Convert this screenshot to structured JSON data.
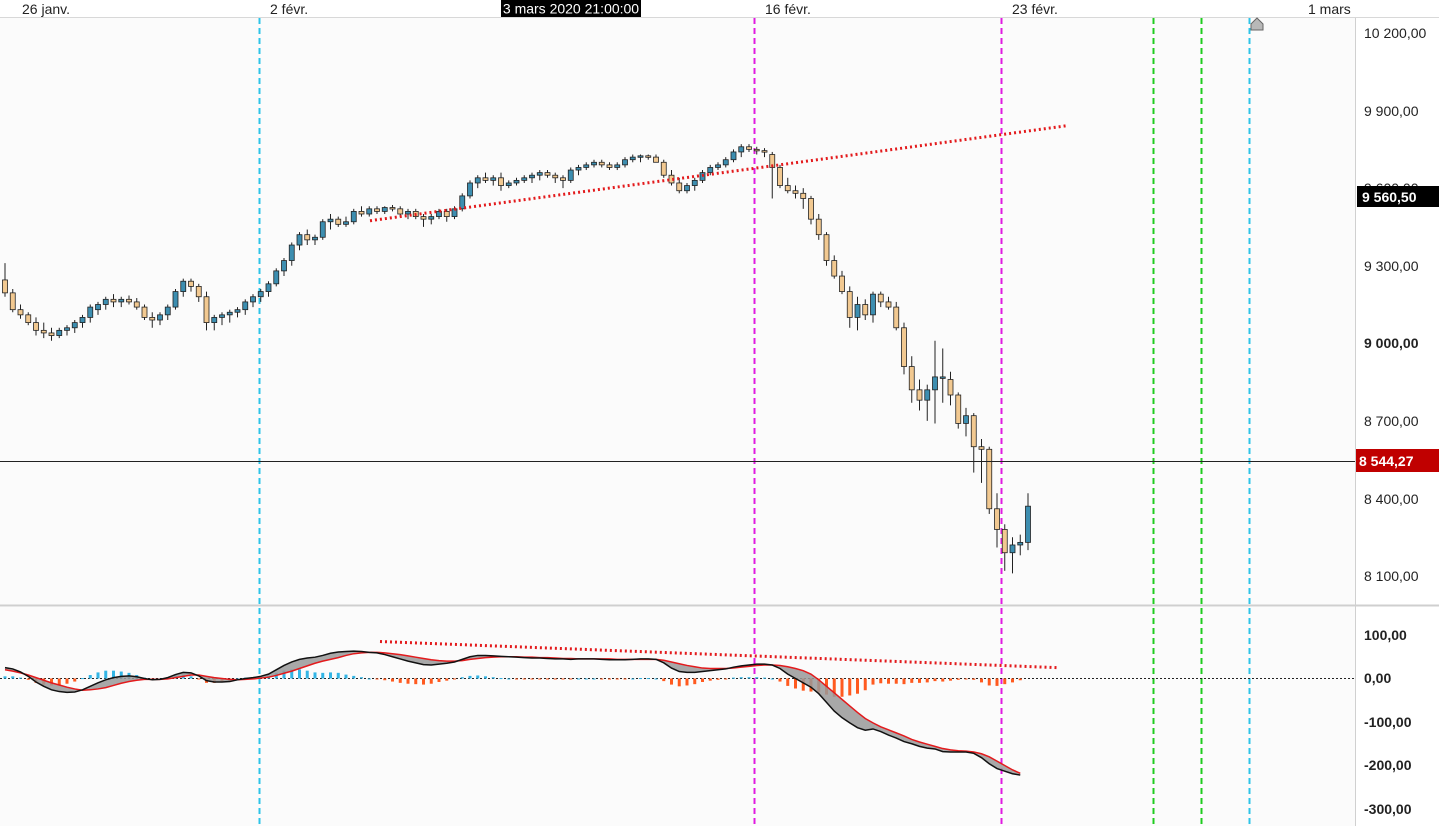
{
  "header": {
    "cursor_time": "3 mars 2020 21:00:00"
  },
  "chart_data": [
    {
      "type": "candlestick",
      "instrument_panel": "price",
      "x_labels": [
        "26 janv.",
        "2 févr.",
        "16 févr.",
        "23 févr.",
        "1 mars"
      ],
      "y_ticks": [
        "10 200,00",
        "9 900,00",
        "9 600,00",
        "9 300,00",
        "9 000,00",
        "8 700,00",
        "8 400,00",
        "8 100,00"
      ],
      "ylim": [
        8050,
        10260
      ],
      "last_price": "9 560,50",
      "crosshair_price": "8 544,27",
      "candles": [
        [
          9245,
          9310,
          9180,
          9195
        ],
        [
          9195,
          9210,
          9120,
          9130
        ],
        [
          9130,
          9150,
          9095,
          9110
        ],
        [
          9110,
          9120,
          9070,
          9080
        ],
        [
          9080,
          9100,
          9030,
          9050
        ],
        [
          9050,
          9080,
          9020,
          9040
        ],
        [
          9040,
          9060,
          9010,
          9030
        ],
        [
          9030,
          9060,
          9020,
          9050
        ],
        [
          9050,
          9070,
          9030,
          9060
        ],
        [
          9060,
          9090,
          9040,
          9080
        ],
        [
          9080,
          9110,
          9060,
          9100
        ],
        [
          9100,
          9150,
          9080,
          9140
        ],
        [
          9130,
          9160,
          9110,
          9150
        ],
        [
          9150,
          9180,
          9130,
          9170
        ],
        [
          9170,
          9190,
          9140,
          9160
        ],
        [
          9160,
          9180,
          9140,
          9170
        ],
        [
          9170,
          9185,
          9150,
          9160
        ],
        [
          9160,
          9175,
          9130,
          9140
        ],
        [
          9140,
          9150,
          9090,
          9100
        ],
        [
          9100,
          9120,
          9060,
          9090
        ],
        [
          9090,
          9120,
          9070,
          9110
        ],
        [
          9110,
          9150,
          9090,
          9140
        ],
        [
          9140,
          9210,
          9130,
          9200
        ],
        [
          9200,
          9250,
          9180,
          9240
        ],
        [
          9240,
          9250,
          9200,
          9220
        ],
        [
          9220,
          9230,
          9160,
          9180
        ],
        [
          9180,
          9200,
          9050,
          9080
        ],
        [
          9080,
          9110,
          9050,
          9100
        ],
        [
          9100,
          9120,
          9070,
          9110
        ],
        [
          9110,
          9130,
          9080,
          9120
        ],
        [
          9120,
          9140,
          9100,
          9130
        ],
        [
          9130,
          9170,
          9110,
          9160
        ],
        [
          9160,
          9190,
          9140,
          9180
        ],
        [
          9180,
          9210,
          9160,
          9200
        ],
        [
          9200,
          9240,
          9180,
          9230
        ],
        [
          9230,
          9290,
          9220,
          9280
        ],
        [
          9280,
          9330,
          9260,
          9320
        ],
        [
          9320,
          9390,
          9300,
          9380
        ],
        [
          9380,
          9430,
          9360,
          9420
        ],
        [
          9420,
          9440,
          9380,
          9400
        ],
        [
          9400,
          9420,
          9380,
          9410
        ],
        [
          9410,
          9480,
          9400,
          9470
        ],
        [
          9470,
          9500,
          9440,
          9480
        ],
        [
          9480,
          9490,
          9450,
          9460
        ],
        [
          9460,
          9490,
          9450,
          9470
        ],
        [
          9470,
          9520,
          9460,
          9510
        ],
        [
          9510,
          9530,
          9490,
          9500
        ],
        [
          9500,
          9530,
          9490,
          9520
        ],
        [
          9520,
          9530,
          9500,
          9510
        ],
        [
          9510,
          9530,
          9500,
          9525
        ],
        [
          9525,
          9535,
          9510,
          9520
        ],
        [
          9520,
          9530,
          9490,
          9500
        ],
        [
          9500,
          9520,
          9480,
          9510
        ],
        [
          9510,
          9520,
          9480,
          9490
        ],
        [
          9490,
          9500,
          9450,
          9480
        ],
        [
          9480,
          9500,
          9460,
          9490
        ],
        [
          9490,
          9520,
          9480,
          9510
        ],
        [
          9510,
          9520,
          9470,
          9490
        ],
        [
          9490,
          9530,
          9480,
          9520
        ],
        [
          9520,
          9580,
          9510,
          9570
        ],
        [
          9570,
          9630,
          9560,
          9620
        ],
        [
          9620,
          9650,
          9600,
          9640
        ],
        [
          9640,
          9660,
          9620,
          9630
        ],
        [
          9630,
          9650,
          9610,
          9640
        ],
        [
          9640,
          9660,
          9590,
          9610
        ],
        [
          9610,
          9630,
          9600,
          9620
        ],
        [
          9620,
          9640,
          9610,
          9630
        ],
        [
          9630,
          9650,
          9620,
          9640
        ],
        [
          9640,
          9660,
          9620,
          9650
        ],
        [
          9650,
          9670,
          9630,
          9660
        ],
        [
          9660,
          9670,
          9640,
          9650
        ],
        [
          9650,
          9660,
          9620,
          9640
        ],
        [
          9640,
          9650,
          9600,
          9630
        ],
        [
          9630,
          9680,
          9620,
          9670
        ],
        [
          9670,
          9690,
          9650,
          9680
        ],
        [
          9680,
          9700,
          9670,
          9690
        ],
        [
          9690,
          9710,
          9680,
          9700
        ],
        [
          9700,
          9710,
          9680,
          9690
        ],
        [
          9690,
          9700,
          9670,
          9680
        ],
        [
          9680,
          9700,
          9670,
          9690
        ],
        [
          9690,
          9720,
          9680,
          9710
        ],
        [
          9710,
          9730,
          9700,
          9720
        ],
        [
          9720,
          9730,
          9700,
          9725
        ],
        [
          9725,
          9730,
          9710,
          9720
        ],
        [
          9720,
          9730,
          9700,
          9700
        ],
        [
          9700,
          9710,
          9640,
          9650
        ],
        [
          9650,
          9670,
          9610,
          9620
        ],
        [
          9620,
          9640,
          9580,
          9590
        ],
        [
          9590,
          9620,
          9580,
          9610
        ],
        [
          9610,
          9640,
          9590,
          9630
        ],
        [
          9630,
          9670,
          9620,
          9660
        ],
        [
          9660,
          9690,
          9650,
          9680
        ],
        [
          9680,
          9700,
          9670,
          9690
        ],
        [
          9690,
          9720,
          9680,
          9710
        ],
        [
          9710,
          9750,
          9700,
          9740
        ],
        [
          9740,
          9770,
          9720,
          9760
        ],
        [
          9760,
          9770,
          9740,
          9750
        ],
        [
          9750,
          9760,
          9730,
          9745
        ],
        [
          9745,
          9755,
          9720,
          9740
        ],
        [
          9730,
          9740,
          9560,
          9680
        ],
        [
          9680,
          9690,
          9600,
          9610
        ],
        [
          9610,
          9640,
          9580,
          9590
        ],
        [
          9590,
          9610,
          9560,
          9580
        ],
        [
          9580,
          9600,
          9520,
          9560
        ],
        [
          9560,
          9570,
          9460,
          9480
        ],
        [
          9480,
          9500,
          9400,
          9420
        ],
        [
          9420,
          9430,
          9300,
          9320
        ],
        [
          9320,
          9340,
          9250,
          9260
        ],
        [
          9260,
          9280,
          9190,
          9200
        ],
        [
          9200,
          9220,
          9060,
          9100
        ],
        [
          9100,
          9180,
          9050,
          9150
        ],
        [
          9150,
          9170,
          9090,
          9110
        ],
        [
          9110,
          9200,
          9080,
          9190
        ],
        [
          9190,
          9200,
          9140,
          9160
        ],
        [
          9160,
          9180,
          9130,
          9140
        ],
        [
          9140,
          9160,
          9050,
          9060
        ],
        [
          9060,
          9080,
          8880,
          8910
        ],
        [
          8910,
          8950,
          8770,
          8820
        ],
        [
          8820,
          8860,
          8740,
          8780
        ],
        [
          8780,
          8840,
          8700,
          8820
        ],
        [
          8820,
          9010,
          8690,
          8870
        ],
        [
          8870,
          8980,
          8770,
          8870
        ],
        [
          8860,
          8890,
          8760,
          8800
        ],
        [
          8800,
          8810,
          8670,
          8690
        ],
        [
          8690,
          8750,
          8640,
          8720
        ],
        [
          8720,
          8730,
          8500,
          8600
        ],
        [
          8600,
          8630,
          8460,
          8590
        ],
        [
          8590,
          8600,
          8340,
          8360
        ],
        [
          8360,
          8420,
          8210,
          8280
        ],
        [
          8280,
          8300,
          8120,
          8190
        ],
        [
          8190,
          8250,
          8110,
          8220
        ],
        [
          8220,
          8260,
          8180,
          8230
        ],
        [
          8230,
          8420,
          8200,
          8370
        ]
      ],
      "trendline": {
        "style": "dotted",
        "color": "#e31a1c",
        "from": [
          9474,
          1
        ],
        "to": [
          9841,
          0
        ]
      },
      "price_line": 8544.27,
      "cursor_marker": "home-marker-icon"
    },
    {
      "type": "line+histogram",
      "instrument_panel": "macd",
      "y_ticks": [
        "100,00",
        "0,00",
        "-100,00",
        "-200,00",
        "-300,00"
      ],
      "ylim": [
        -310,
        120
      ],
      "macd": [
        25,
        22,
        15,
        5,
        -8,
        -18,
        -26,
        -30,
        -32,
        -31,
        -26,
        -18,
        -10,
        -3,
        2,
        5,
        6,
        4,
        0,
        -3,
        -2,
        2,
        9,
        14,
        13,
        6,
        -5,
        -8,
        -8,
        -7,
        -3,
        0,
        2,
        5,
        10,
        20,
        30,
        38,
        44,
        47,
        49,
        53,
        58,
        61,
        62,
        63,
        62,
        60,
        59,
        55,
        50,
        45,
        40,
        36,
        32,
        31,
        33,
        35,
        38,
        44,
        50,
        53,
        53,
        52,
        51,
        50,
        49,
        48,
        47,
        47,
        46,
        45,
        45,
        44,
        45,
        45,
        45,
        44,
        43,
        43,
        43,
        44,
        45,
        45,
        44,
        36,
        24,
        16,
        14,
        14,
        16,
        18,
        20,
        22,
        26,
        29,
        31,
        33,
        33,
        31,
        23,
        10,
        0,
        -10,
        -20,
        -35,
        -55,
        -75,
        -90,
        -102,
        -113,
        -119,
        -116,
        -122,
        -130,
        -137,
        -145,
        -150,
        -156,
        -160,
        -162,
        -168,
        -169,
        -169,
        -169,
        -172,
        -182,
        -196,
        -207,
        -213,
        -219,
        -222
      ],
      "signal": [
        20,
        17,
        13,
        8,
        2,
        -4,
        -10,
        -15,
        -20,
        -24,
        -27,
        -26,
        -24,
        -21,
        -16,
        -11,
        -7,
        -4,
        -2,
        -2,
        -2,
        -1,
        2,
        5,
        8,
        8,
        5,
        2,
        0,
        -2,
        -3,
        -2,
        -1,
        1,
        3,
        7,
        12,
        17,
        23,
        29,
        35,
        40,
        44,
        48,
        53,
        57,
        59,
        60,
        60,
        59,
        57,
        55,
        52,
        49,
        46,
        43,
        41,
        40,
        40,
        41,
        44,
        46,
        48,
        49,
        50,
        50,
        50,
        49,
        49,
        48,
        48,
        47,
        46,
        46,
        45,
        45,
        45,
        45,
        45,
        44,
        44,
        44,
        44,
        44,
        44,
        42,
        38,
        34,
        30,
        27,
        24,
        23,
        23,
        23,
        24,
        26,
        28,
        30,
        31,
        31,
        30,
        27,
        23,
        18,
        10,
        -3,
        -18,
        -33,
        -48,
        -63,
        -78,
        -92,
        -102,
        -111,
        -118,
        -125,
        -132,
        -140,
        -146,
        -151,
        -156,
        -161,
        -164,
        -166,
        -167,
        -169,
        -173,
        -180,
        -190,
        -200,
        -210,
        -218
      ],
      "trendline": {
        "style": "dotted",
        "color": "#e31a1c",
        "from": [
          85,
          7
        ],
        "to": [
          25,
          0
        ]
      },
      "zero_line": 0
    }
  ],
  "colors": {
    "bull_body": "#3d8eb0",
    "bear_body": "#f2c991",
    "wick": "#222222",
    "hist_positive": "#33b5e5",
    "hist_negative": "#ff5a1f",
    "macd_line": "#111111",
    "signal_line": "#e31a1c",
    "fill": "#999999",
    "vline_cyan": "#2ec4e8",
    "vline_magenta": "#e01be0",
    "vline_green": "#1fcc1f",
    "last_price_bg": "#000000",
    "crosshair_bg": "#c00000"
  }
}
